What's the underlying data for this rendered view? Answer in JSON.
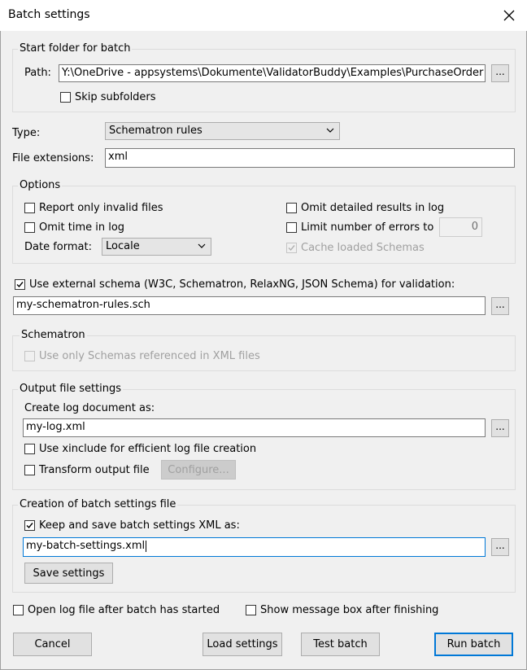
{
  "window": {
    "title": "Batch settings"
  },
  "start_folder": {
    "legend": "Start folder for batch",
    "path_label": "Path:",
    "path_value": "Y:\\OneDrive - appsystems\\Dokumente\\ValidatorBuddy\\Examples\\PurchaseOrder",
    "browse_label": "...",
    "skip_subfolders_label": "Skip subfolders",
    "skip_subfolders_checked": false
  },
  "type": {
    "label": "Type:",
    "value": "Schematron rules"
  },
  "extensions": {
    "label": "File extensions:",
    "value": "xml"
  },
  "options": {
    "legend": "Options",
    "report_invalid_label": "Report only invalid files",
    "omit_time_label": "Omit time in log",
    "date_format_label": "Date format:",
    "date_format_value": "Locale",
    "omit_detailed_label": "Omit detailed results in log",
    "limit_errors_label": "Limit number of errors to",
    "limit_errors_value": "0",
    "cache_schemas_label": "Cache loaded Schemas",
    "cache_schemas_checked": true,
    "cache_schemas_disabled": true
  },
  "external_schema": {
    "label": "Use external schema (W3C, Schematron, RelaxNG, JSON Schema) for validation:",
    "checked": true,
    "value": "my-schematron-rules.sch",
    "browse_label": "..."
  },
  "schematron": {
    "legend": "Schematron",
    "referenced_only_label": "Use only Schemas referenced in XML files",
    "disabled": true
  },
  "output": {
    "legend": "Output file settings",
    "create_log_label": "Create log document as:",
    "log_value": "my-log.xml",
    "browse_label": "...",
    "xinclude_label": "Use xinclude for efficient log file creation",
    "transform_label": "Transform output file",
    "configure_label": "Configure..."
  },
  "batch_file": {
    "legend": "Creation of batch settings file",
    "keep_label": "Keep and save batch settings XML as:",
    "keep_checked": true,
    "value": "my-batch-settings.xml",
    "browse_label": "...",
    "save_label": "Save settings"
  },
  "footer": {
    "open_log_label": "Open log file after batch has started",
    "show_message_label": "Show message box after finishing",
    "cancel_label": "Cancel",
    "load_label": "Load settings",
    "test_label": "Test batch",
    "run_label": "Run batch"
  },
  "colors": {
    "accent": "#0078d7",
    "background": "#f0f0f0"
  }
}
